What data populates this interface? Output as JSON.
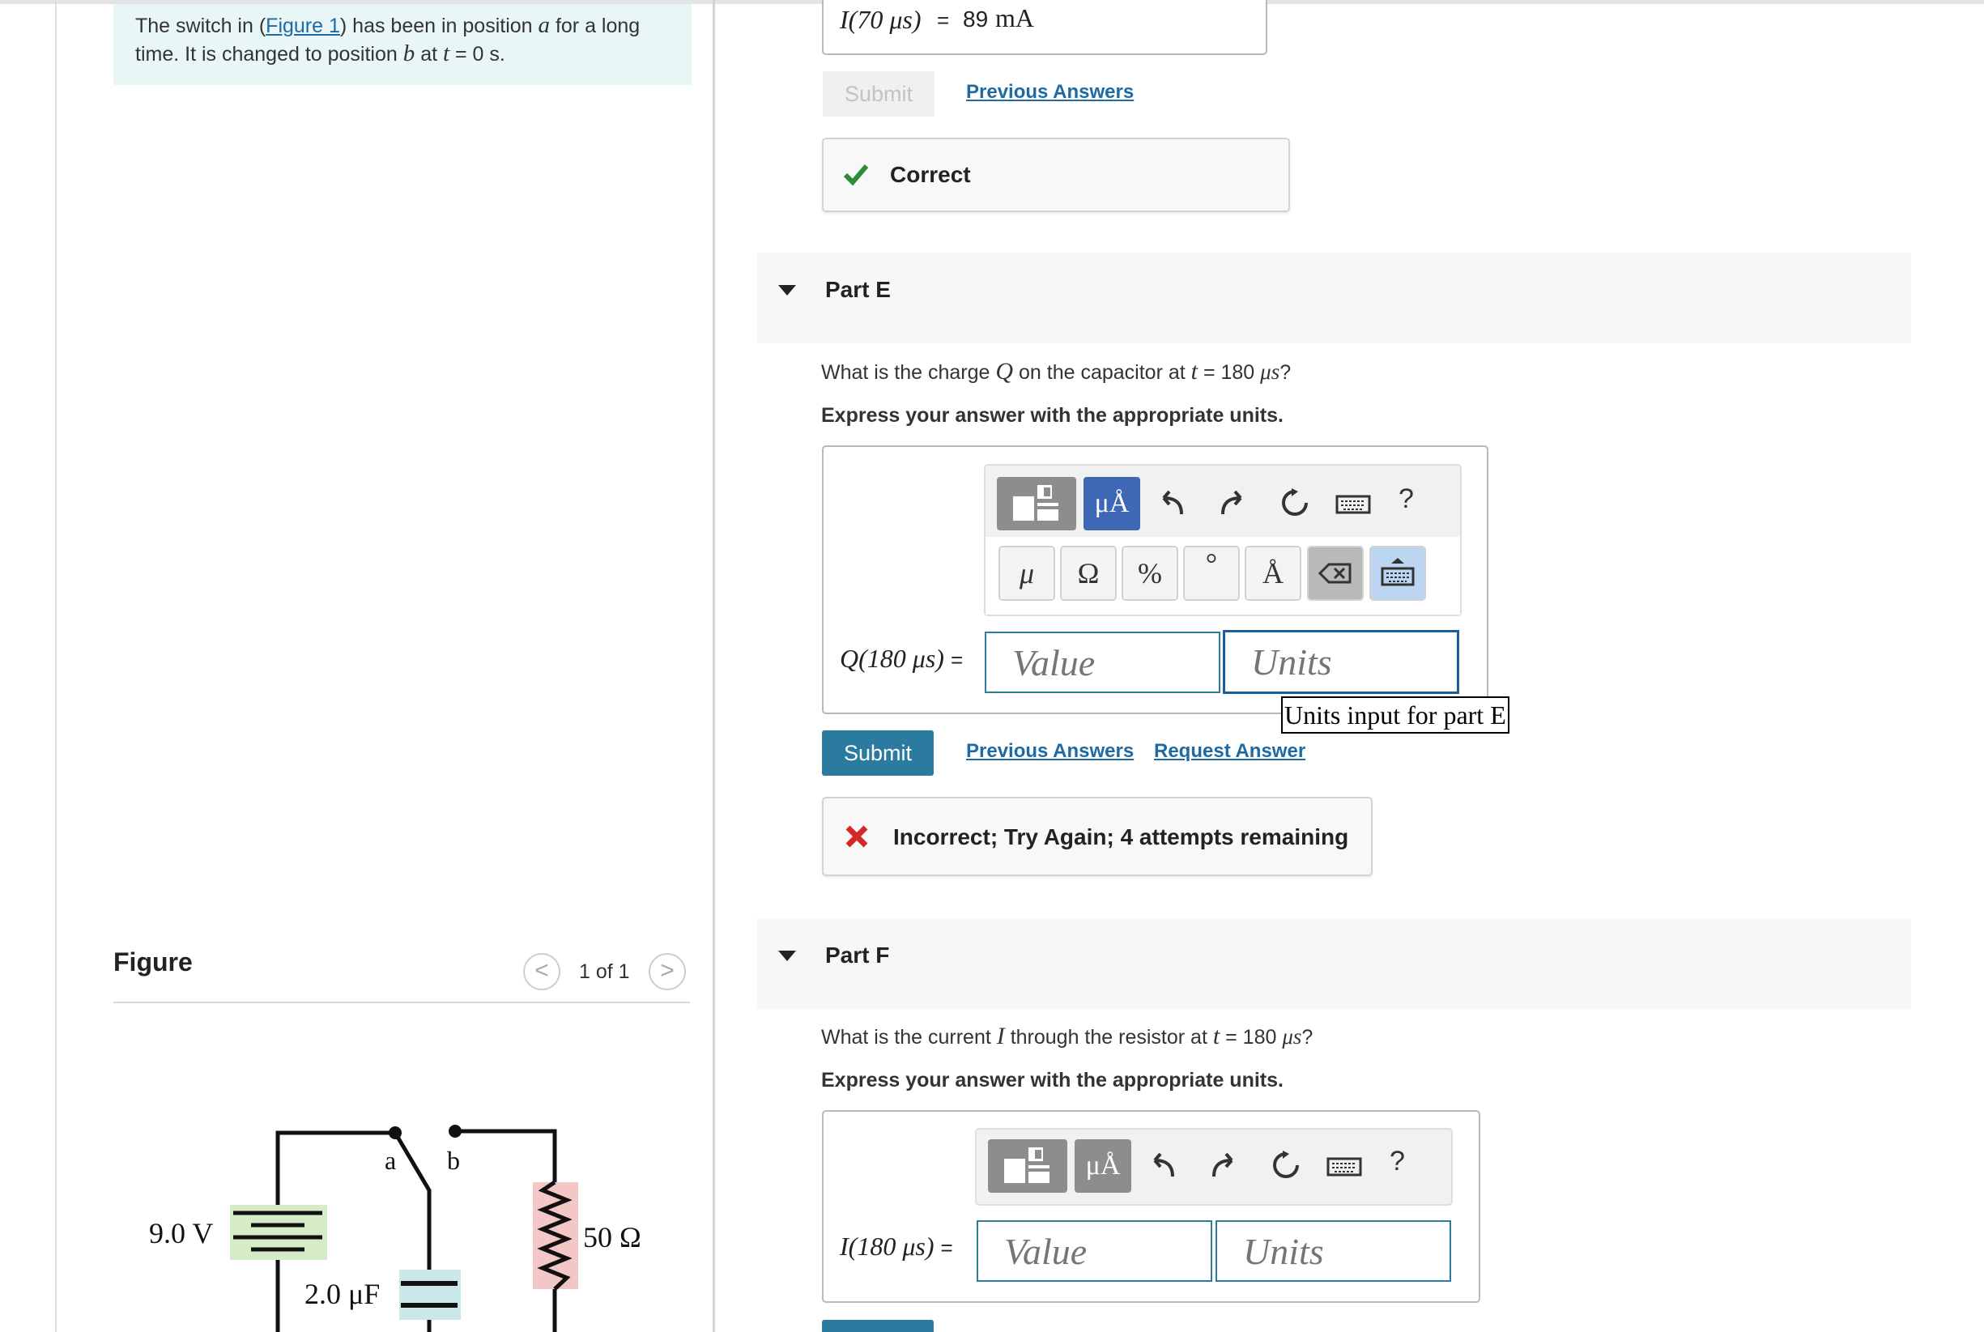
{
  "problem": {
    "text_1": "The switch in (",
    "figure_link": "Figure 1",
    "text_2": ") has been in position ",
    "pos_a": "a",
    "text_3": " for a long time. It is changed to position ",
    "pos_b": "b",
    "text_4": " at ",
    "t": "t",
    "text_5": " = 0 s."
  },
  "figure": {
    "title": "Figure",
    "pager": "1 of 1",
    "prev_glyph": "<",
    "next_glyph": ">",
    "labels": {
      "battery": "9.0 V",
      "capacitor": "2.0 μF",
      "resistor": "50 Ω",
      "a": "a",
      "b": "b"
    },
    "colors": {
      "battery_fill": "#d6ebc8",
      "capacitor_fill": "#cce7e7",
      "resistor_fill": "#f4c7c7"
    }
  },
  "part_d": {
    "answer_label": "I(70 μs)",
    "answer_eq": "=",
    "answer_value": "89",
    "answer_unit": "mA",
    "submit_label": "Submit",
    "previous_answers": "Previous Answers",
    "feedback": "Correct",
    "feedback_color": "#2e8b3a"
  },
  "part_e": {
    "title": "Part E",
    "q_1": "What is the charge ",
    "q_var": "Q",
    "q_2": " on the capacitor at ",
    "q_t": "t",
    "q_3": " = 180 ",
    "q_mu": "μs",
    "q_4": "?",
    "note": "Express your answer with the appropriate units.",
    "answer_label": "Q(180 μs)",
    "answer_eq": "=",
    "value_placeholder": "Value",
    "units_placeholder": "Units",
    "tooltip": "Units input for part E",
    "submit_label": "Submit",
    "previous_answers": "Previous Answers",
    "request_answer": "Request Answer",
    "feedback": "Incorrect; Try Again; 4 attempts remaining",
    "feedback_color": "#d62828"
  },
  "toolbar": {
    "units_button": "μÅ",
    "help": "?",
    "keys": [
      "μ",
      "Ω",
      "%",
      "°",
      "Å"
    ]
  },
  "part_f": {
    "title": "Part F",
    "q_1": "What is the current ",
    "q_var": "I",
    "q_2": " through the resistor at ",
    "q_t": "t",
    "q_3": " = 180 ",
    "q_mu": "μs",
    "q_4": "?",
    "note": "Express your answer with the appropriate units.",
    "answer_label": "I(180 μs)",
    "answer_eq": "=",
    "value_placeholder": "Value",
    "units_placeholder": "Units"
  },
  "colors": {
    "accent": "#2b7aa0",
    "link": "#1d6aa5",
    "problem_bg": "#e9f6f6"
  }
}
